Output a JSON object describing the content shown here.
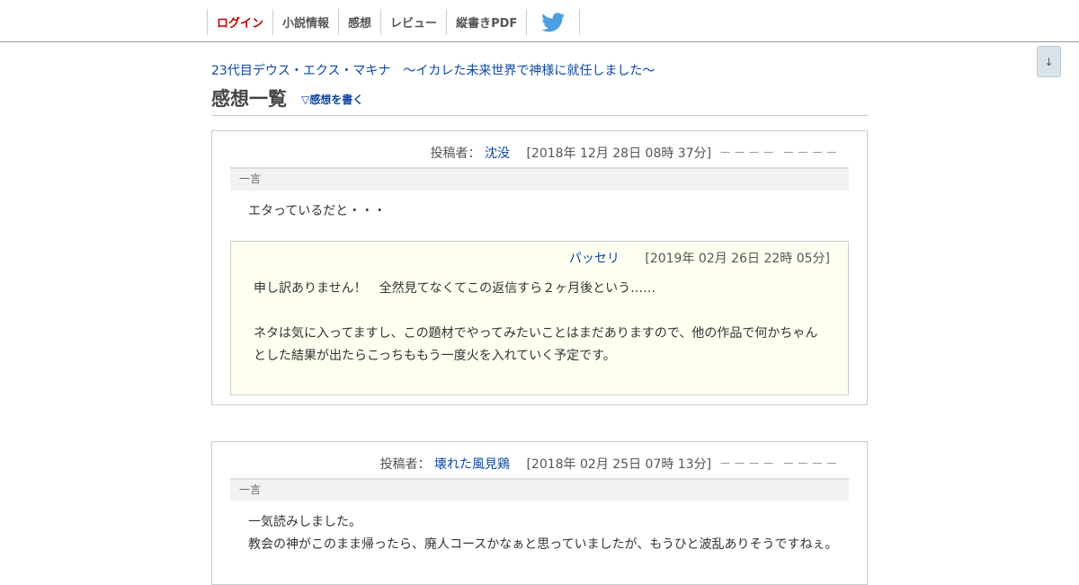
{
  "nav": {
    "items": [
      {
        "label": "ログイン"
      },
      {
        "label": "小説情報"
      },
      {
        "label": "感想"
      },
      {
        "label": "レビュー"
      },
      {
        "label": "縦書きPDF"
      }
    ],
    "twitter_icon": "twitter-bird-icon",
    "accent_color": "#c00000"
  },
  "scroll_button": {
    "label": "↓"
  },
  "header": {
    "novel_title": "23代目デウス・エクス・マキナ　～イカレた未来世界で神様に就任しました～",
    "page_title": "感想一覧",
    "write_link": "▽感想を書く"
  },
  "comments": [
    {
      "poster_label": "投稿者：",
      "poster": "沈没",
      "date": "[2018年 12月 28日 08時 37分]",
      "dashes": "－－－－ －－－－",
      "section_label": "一言",
      "text": "エタっているだと・・・",
      "reply": {
        "author": "パッセリ",
        "date": "[2019年 02月 26日 22時 05分]",
        "text": "申し訳ありません！　全然見てなくてこの返信すら２ヶ月後という……\n\nネタは気に入ってますし、この題材でやってみたいことはまだありますので、他の作品で何かちゃんとした結果が出たらこっちももう一度火を入れていく予定です。"
      }
    },
    {
      "poster_label": "投稿者：",
      "poster": "壊れた風見鶏",
      "date": "[2018年 02月 25日 07時 13分]",
      "dashes": "－－－－ －－－－",
      "section_label": "一言",
      "text": "一気読みしました。\n教会の神がこのまま帰ったら、廃人コースかなぁと思っていましたが、もうひと波乱ありそうですねぇ。"
    }
  ]
}
